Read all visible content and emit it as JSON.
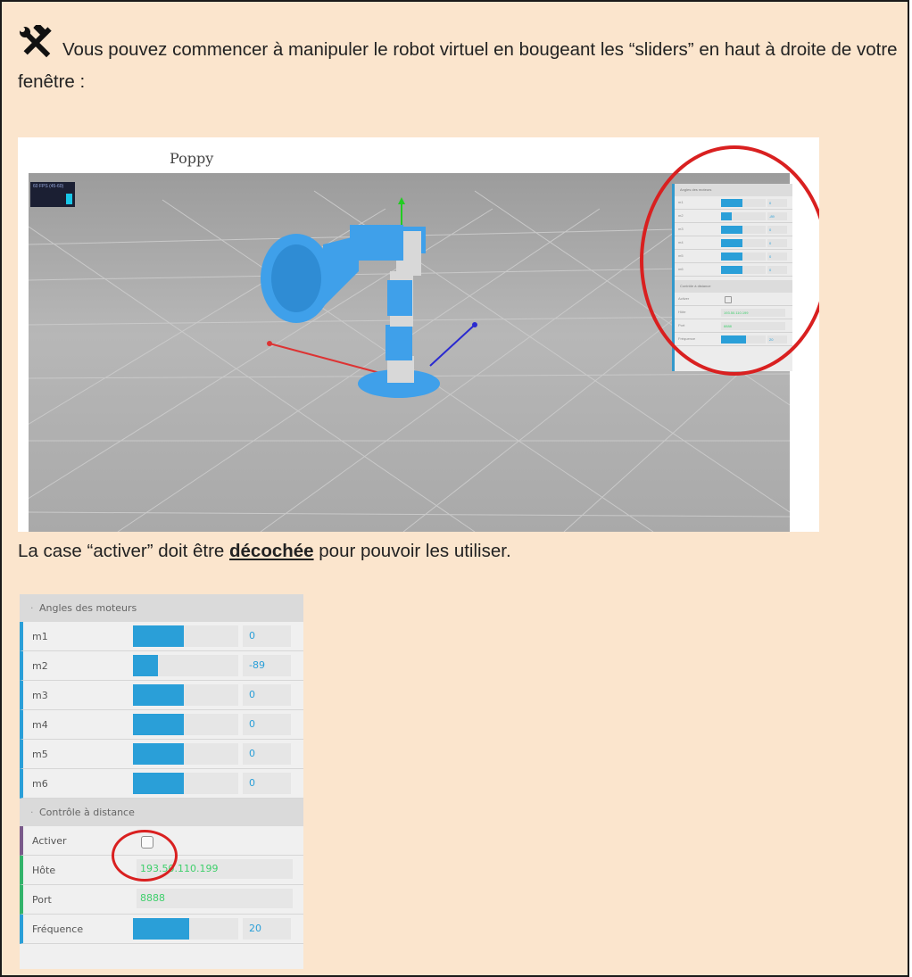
{
  "intro_text": "Vous pouvez commencer à manipuler le robot virtuel en bougeant les “sliders” en haut à droite de votre fenêtre :",
  "icons": {
    "tools": "hammer-wrench-icon"
  },
  "screenshot": {
    "title": "Poppy",
    "fps_label": "60 FPS (45-60)"
  },
  "note": {
    "before": "La case “activer” doit être ",
    "emphasis": "décochée",
    "after": " pour pouvoir les utiliser."
  },
  "panel": {
    "motors_header": "Angles des moteurs",
    "motors": [
      {
        "label": "m1",
        "value": "0",
        "fill": 0.48
      },
      {
        "label": "m2",
        "value": "-89",
        "fill": 0.24
      },
      {
        "label": "m3",
        "value": "0",
        "fill": 0.48
      },
      {
        "label": "m4",
        "value": "0",
        "fill": 0.48
      },
      {
        "label": "m5",
        "value": "0",
        "fill": 0.48
      },
      {
        "label": "m6",
        "value": "0",
        "fill": 0.48
      }
    ],
    "remote_header": "Contrôle à distance",
    "activer_label": "Activer",
    "activer_checked": false,
    "host_label": "Hôte",
    "host_value": "193.50.110.199",
    "port_label": "Port",
    "port_value": "8888",
    "freq_label": "Fréquence",
    "freq_value": "20",
    "freq_fill": 0.53
  },
  "colors": {
    "accent": "#2a9fd8",
    "highlight": "#d92020",
    "background": "#fbe5cd"
  }
}
